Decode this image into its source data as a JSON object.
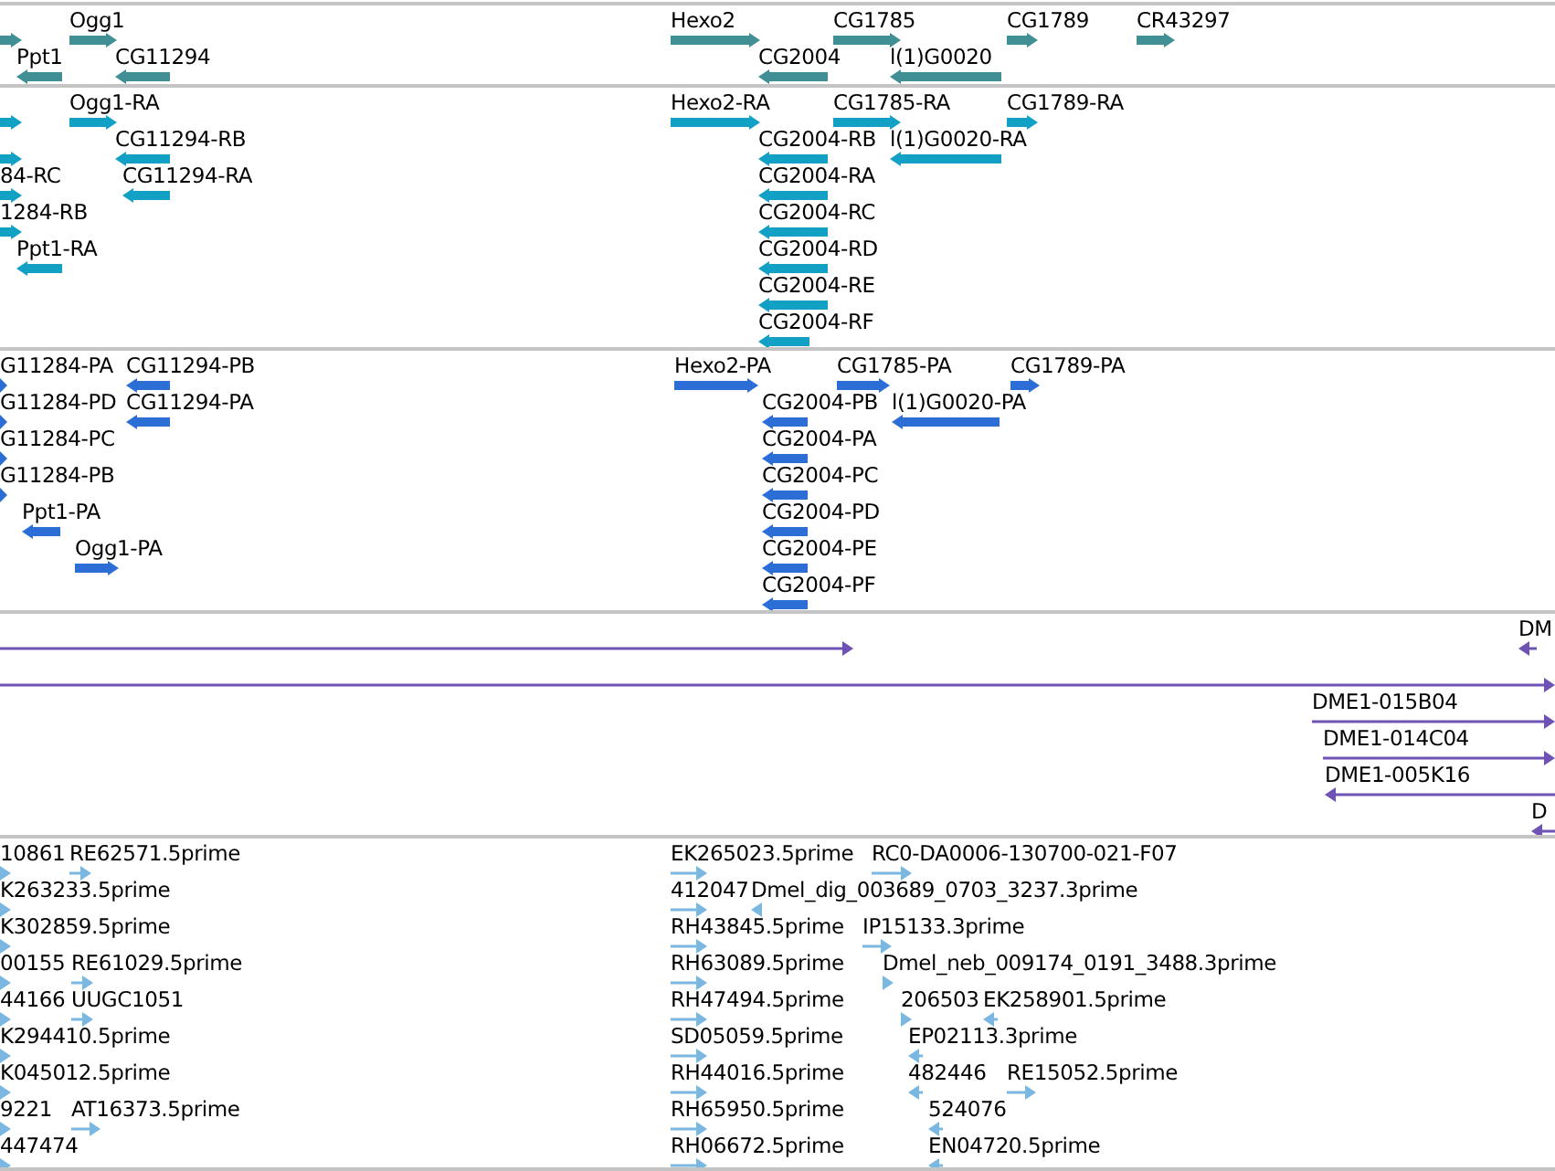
{
  "tracks": [
    {
      "color": "#3f8f94",
      "features": [
        {
          "reverse": false
        },
        {
          "label": "Ogg1",
          "reverse": false
        },
        {
          "label": "Ppt1",
          "reverse": true
        },
        {
          "label": "CG11294",
          "reverse": true
        },
        {
          "label": "Hexo2",
          "reverse": false
        },
        {
          "label": "CG1785",
          "reverse": false
        },
        {
          "label": "CG1789",
          "reverse": false
        },
        {
          "label": "CR43297",
          "reverse": false
        },
        {
          "label": "CG2004",
          "reverse": true
        },
        {
          "label": "l(1)G0020",
          "reverse": true
        }
      ]
    },
    {
      "color": "#12a0c4",
      "features": [
        {
          "reverse": false
        },
        {
          "label": "Ogg1-RA",
          "reverse": false
        },
        {
          "reverse": false
        },
        {
          "label": "CG11294-RB",
          "reverse": true
        },
        {
          "label": "84-RC",
          "reverse": false
        },
        {
          "label": "CG11294-RA",
          "reverse": true
        },
        {
          "label": "1284-RB",
          "reverse": false
        },
        {
          "label": "Ppt1-RA",
          "reverse": true
        },
        {
          "label": "Hexo2-RA",
          "reverse": false
        },
        {
          "label": "CG1785-RA",
          "reverse": false
        },
        {
          "label": "CG1789-RA",
          "reverse": false
        },
        {
          "label": "CG2004-RB",
          "reverse": true
        },
        {
          "label": "l(1)G0020-RA",
          "reverse": true
        },
        {
          "label": "CG2004-RA",
          "reverse": true
        },
        {
          "label": "CG2004-RC",
          "reverse": true
        },
        {
          "label": "CG2004-RD",
          "reverse": true
        },
        {
          "label": "CG2004-RE",
          "reverse": true
        },
        {
          "label": "CG2004-RF",
          "reverse": true
        }
      ]
    },
    {
      "color": "#2d6ed6",
      "features": [
        {
          "label": "G11284-PA",
          "reverse": false
        },
        {
          "label": "CG11294-PB",
          "reverse": true
        },
        {
          "label": "G11284-PD",
          "reverse": false
        },
        {
          "label": "CG11294-PA",
          "reverse": true
        },
        {
          "label": "G11284-PC",
          "reverse": false
        },
        {
          "label": "G11284-PB",
          "reverse": false
        },
        {
          "label": "Ppt1-PA",
          "reverse": true
        },
        {
          "label": "Ogg1-PA",
          "reverse": false
        },
        {
          "label": "Hexo2-PA",
          "reverse": false
        },
        {
          "label": "CG1785-PA",
          "reverse": false
        },
        {
          "label": "CG1789-PA",
          "reverse": false
        },
        {
          "label": "CG2004-PB",
          "reverse": true
        },
        {
          "label": "l(1)G0020-PA",
          "reverse": true
        },
        {
          "label": "CG2004-PA",
          "reverse": true
        },
        {
          "label": "CG2004-PC",
          "reverse": true
        },
        {
          "label": "CG2004-PD",
          "reverse": true
        },
        {
          "label": "CG2004-PE",
          "reverse": true
        },
        {
          "label": "CG2004-PF",
          "reverse": true
        }
      ]
    },
    {
      "color": "#6f52b3",
      "features": [
        {
          "reverse": false
        },
        {
          "label": "DM",
          "reverse": true
        },
        {
          "reverse": false
        },
        {
          "label": "DME1-015B04",
          "reverse": false
        },
        {
          "label": "DME1-014C04",
          "reverse": false
        },
        {
          "label": "DME1-005K16",
          "reverse": true
        },
        {
          "label": "D",
          "reverse": true
        }
      ]
    },
    {
      "color": "#7ab8e2",
      "features": [
        {
          "label": "10861",
          "reverse": false
        },
        {
          "label": "RE62571.5prime",
          "reverse": false
        },
        {
          "label": "K263233.5prime",
          "reverse": false
        },
        {
          "label": "K302859.5prime",
          "reverse": false
        },
        {
          "label": "00155",
          "reverse": false
        },
        {
          "label": "RE61029.5prime",
          "reverse": false
        },
        {
          "label": "44166",
          "reverse": false
        },
        {
          "label": "UUGC1051",
          "reverse": false
        },
        {
          "label": "K294410.5prime",
          "reverse": false
        },
        {
          "label": "K045012.5prime",
          "reverse": false
        },
        {
          "label": "9221",
          "reverse": false
        },
        {
          "label": "AT16373.5prime",
          "reverse": false
        },
        {
          "label": "447474",
          "reverse": false
        },
        {
          "label": "EK265023.5prime",
          "reverse": false
        },
        {
          "label": "RC0-DA0006-130700-021-F07",
          "reverse": false
        },
        {
          "label": "412047",
          "reverse": false
        },
        {
          "label": "Dmel_dig_003689_0703_3237.3prime",
          "reverse": true
        },
        {
          "label": "RH43845.5prime",
          "reverse": false
        },
        {
          "label": "IP15133.3prime",
          "reverse": false
        },
        {
          "label": "RH63089.5prime",
          "reverse": false
        },
        {
          "label": "Dmel_neb_009174_0191_3488.3prime",
          "reverse": false
        },
        {
          "label": "RH47494.5prime",
          "reverse": false
        },
        {
          "label": "206503",
          "reverse": false
        },
        {
          "label": "EK258901.5prime",
          "reverse": true
        },
        {
          "label": "SD05059.5prime",
          "reverse": false
        },
        {
          "label": "EP02113.3prime",
          "reverse": true
        },
        {
          "label": "RH44016.5prime",
          "reverse": false
        },
        {
          "label": "482446",
          "reverse": true
        },
        {
          "label": "RE15052.5prime",
          "reverse": false
        },
        {
          "label": "RH65950.5prime",
          "reverse": false
        },
        {
          "label": "524076",
          "reverse": true
        },
        {
          "label": "RH06672.5prime",
          "reverse": false
        },
        {
          "label": "EN04720.5prime",
          "reverse": true
        }
      ]
    }
  ]
}
